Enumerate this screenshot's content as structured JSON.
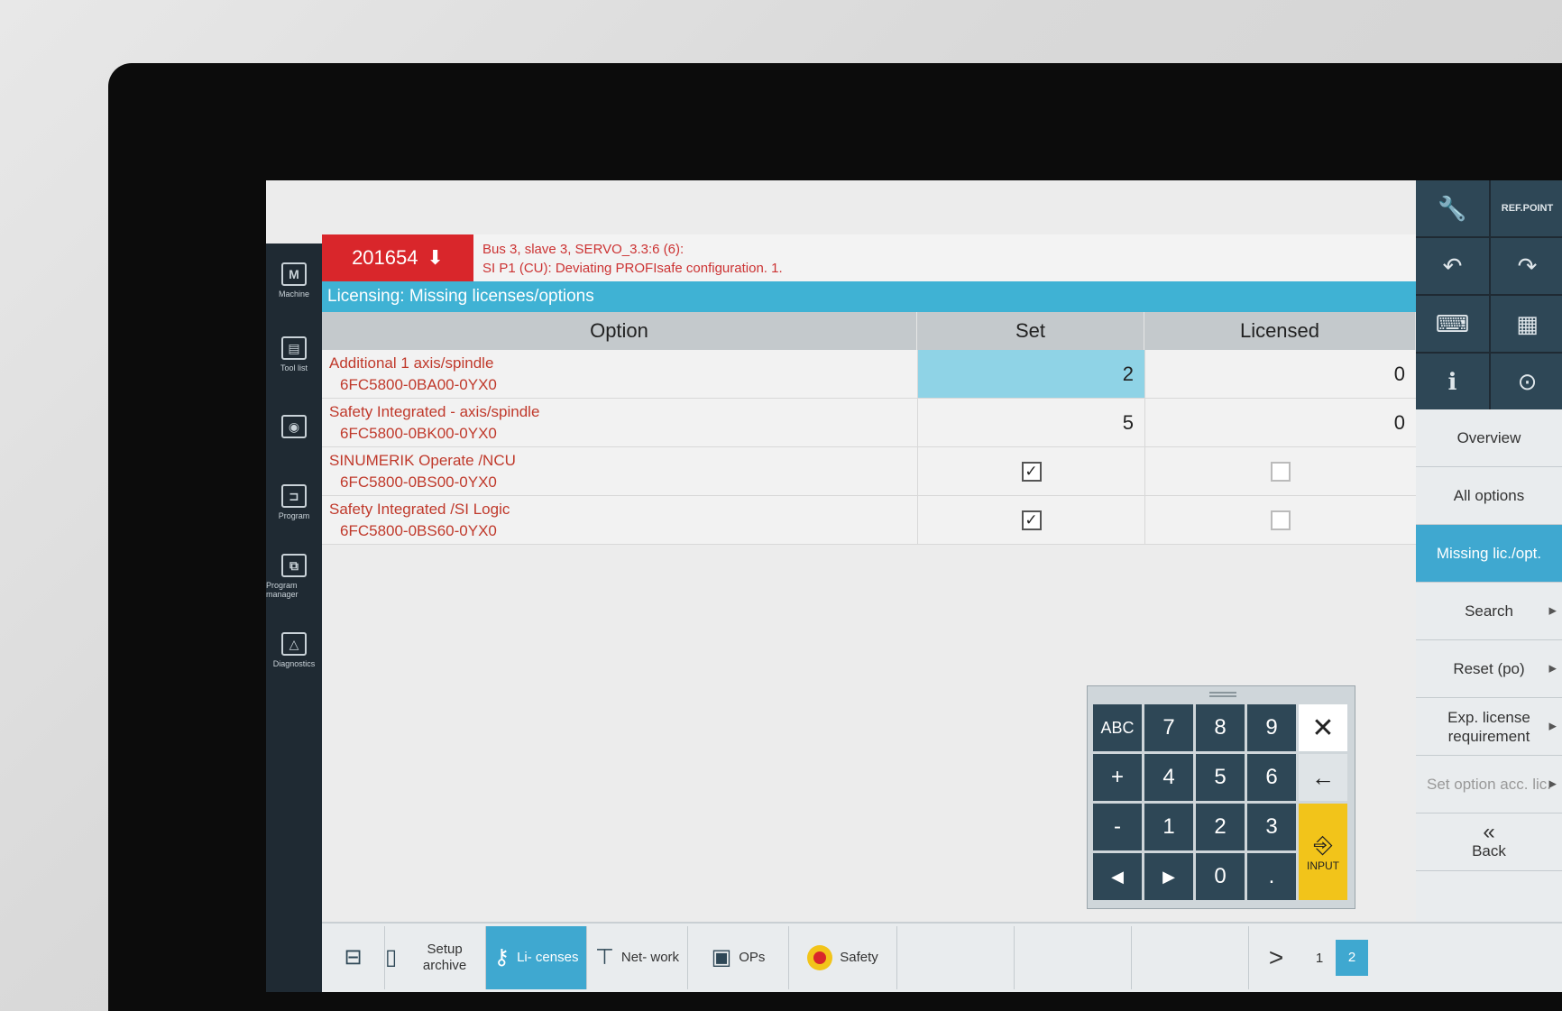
{
  "alarm": {
    "number": "201654",
    "line1": "Bus 3, slave 3, SERVO_3.3:6 (6):",
    "line2": "SI P1 (CU): Deviating PROFIsafe configuration. 1."
  },
  "title": "Licensing: Missing licenses/options",
  "table": {
    "headers": {
      "option": "Option",
      "set": "Set",
      "licensed": "Licensed"
    },
    "rows": [
      {
        "name": "Additional 1 axis/spindle",
        "code": "6FC5800-0BA00-0YX0",
        "set": "2",
        "licensed": "0"
      },
      {
        "name": "Safety Integrated - axis/spindle",
        "code": "6FC5800-0BK00-0YX0",
        "set": "5",
        "licensed": "0"
      },
      {
        "name": "SINUMERIK Operate /NCU",
        "code": "6FC5800-0BS00-0YX0",
        "set_checked": true,
        "licensed_checked": false
      },
      {
        "name": "Safety Integrated /SI Logic",
        "code": "6FC5800-0BS60-0YX0",
        "set_checked": true,
        "licensed_checked": false
      }
    ]
  },
  "left_nav": [
    {
      "label": "Machine",
      "icon": "M"
    },
    {
      "label": "Tool list",
      "icon": "▤"
    },
    {
      "label": "",
      "icon": "◉"
    },
    {
      "label": "Program",
      "icon": "⊐"
    },
    {
      "label": "Program manager",
      "icon": "⧉"
    },
    {
      "label": "Diagnostics",
      "icon": "△"
    }
  ],
  "keypad": {
    "abc": "ABC",
    "keys": [
      "7",
      "8",
      "9",
      "4",
      "5",
      "6",
      "1",
      "2",
      "3",
      "0",
      "."
    ],
    "plus": "+",
    "minus": "-",
    "close": "✕",
    "backspace": "←",
    "left": "◀",
    "right": "▶",
    "input": "INPUT"
  },
  "right_tools": {
    "ref_point": "REF.POINT"
  },
  "right_softkeys": {
    "overview": "Overview",
    "all_options": "All options",
    "missing": "Missing lic./opt.",
    "search": "Search",
    "reset": "Reset (po)",
    "exp_license": "Exp. license requirement",
    "set_option": "Set option acc. lic.",
    "back": "Back"
  },
  "bottom_softkeys": {
    "setup_archive": "Setup archive",
    "licenses": "Li- censes",
    "network": "Net- work",
    "ops": "OPs",
    "safety": "Safety"
  },
  "pages": {
    "next": ">",
    "page1": "1",
    "page2": "2"
  },
  "colors": {
    "accent": "#3fa8d0",
    "alarm": "#d9262b",
    "input": "#f2c41a"
  }
}
